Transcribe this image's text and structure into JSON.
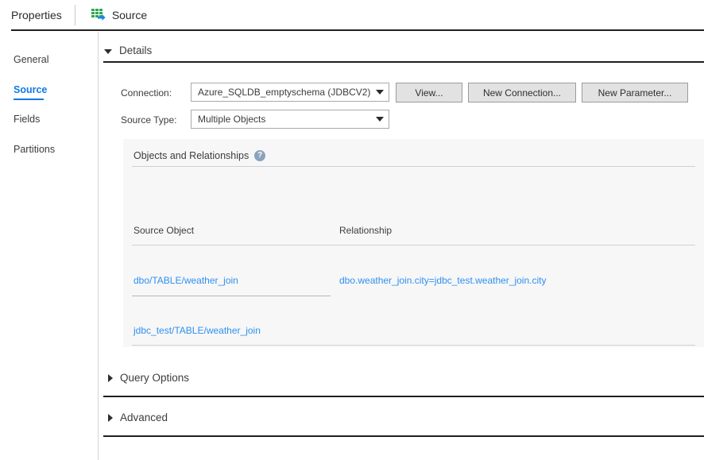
{
  "header": {
    "properties_label": "Properties",
    "source_tab_label": "Source",
    "source_tab_icon": "table-source-icon"
  },
  "sidebar": {
    "items": [
      {
        "label": "General",
        "active": false
      },
      {
        "label": "Source",
        "active": true
      },
      {
        "label": "Fields",
        "active": false
      },
      {
        "label": "Partitions",
        "active": false
      }
    ]
  },
  "sections": {
    "details": {
      "label": "Details",
      "expanded": true
    },
    "query_options": {
      "label": "Query Options",
      "expanded": false
    },
    "advanced": {
      "label": "Advanced",
      "expanded": false
    }
  },
  "details": {
    "connection_label": "Connection:",
    "connection_value": "Azure_SQLDB_emptyschema (JDBCV2)",
    "source_type_label": "Source Type:",
    "source_type_value": "Multiple Objects",
    "buttons": {
      "view": "View...",
      "new_connection": "New Connection...",
      "new_parameter": "New Parameter..."
    }
  },
  "objects_panel": {
    "title": "Objects and Relationships",
    "help_glyph": "?",
    "columns": {
      "source_object": "Source Object",
      "relationship": "Relationship"
    },
    "rows": [
      {
        "source_object": "dbo/TABLE/weather_join",
        "relationship": "dbo.weather_join.city=jdbc_test.weather_join.city"
      },
      {
        "source_object": "jdbc_test/TABLE/weather_join",
        "relationship": ""
      }
    ]
  },
  "colors": {
    "accent_blue": "#0f7ae5",
    "link_blue": "#2e90f0",
    "panel_bg": "#f7f7f7",
    "icon_green": "#2fa84f",
    "help_blue_gray": "#8ba3bd"
  }
}
